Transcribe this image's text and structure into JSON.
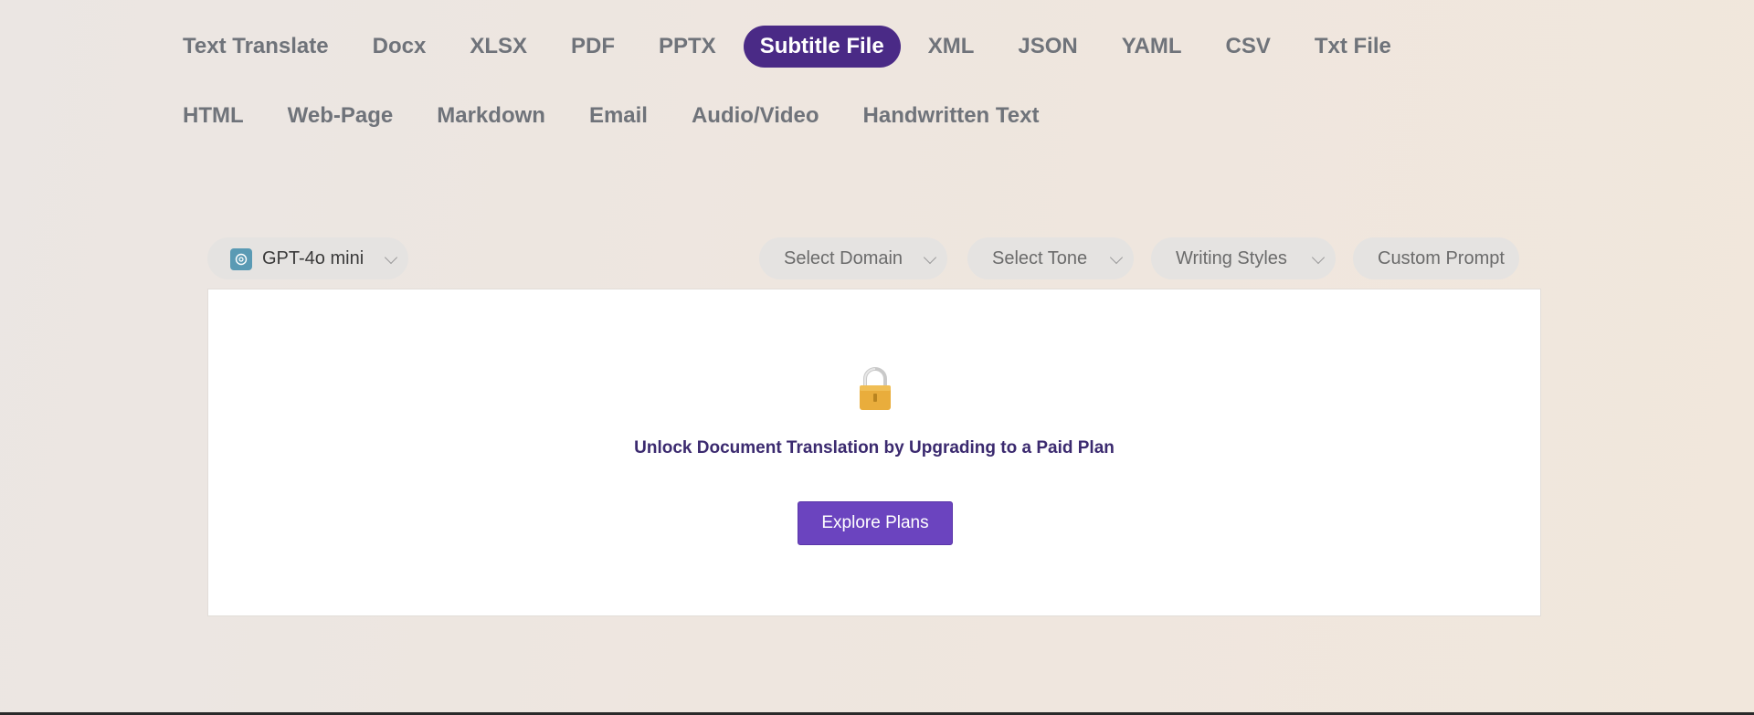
{
  "tabs": [
    {
      "label": "Text Translate",
      "active": false
    },
    {
      "label": "Docx",
      "active": false
    },
    {
      "label": "XLSX",
      "active": false
    },
    {
      "label": "PDF",
      "active": false
    },
    {
      "label": "PPTX",
      "active": false
    },
    {
      "label": "Subtitle File",
      "active": true
    },
    {
      "label": "XML",
      "active": false
    },
    {
      "label": "JSON",
      "active": false
    },
    {
      "label": "YAML",
      "active": false
    },
    {
      "label": "CSV",
      "active": false
    },
    {
      "label": "Txt File",
      "active": false
    },
    {
      "label": "HTML",
      "active": false
    },
    {
      "label": "Web-Page",
      "active": false
    },
    {
      "label": "Markdown",
      "active": false
    },
    {
      "label": "Email",
      "active": false
    },
    {
      "label": "Audio/Video",
      "active": false
    },
    {
      "label": "Handwritten Text",
      "active": false
    }
  ],
  "toolbar": {
    "model": {
      "label": "GPT-4o mini",
      "icon": "openai-logo-icon"
    },
    "domain": "Select Domain",
    "tone": "Select Tone",
    "styles": "Writing Styles",
    "prompt": "Custom Prompt"
  },
  "locked": {
    "icon": "padlock-icon",
    "message": "Unlock Document Translation by Upgrading to a Paid Plan",
    "button": "Explore Plans"
  },
  "colors": {
    "active_tab": "#4a2a86",
    "accent_button": "#6b44bf",
    "message_text": "#3b2a6f"
  }
}
